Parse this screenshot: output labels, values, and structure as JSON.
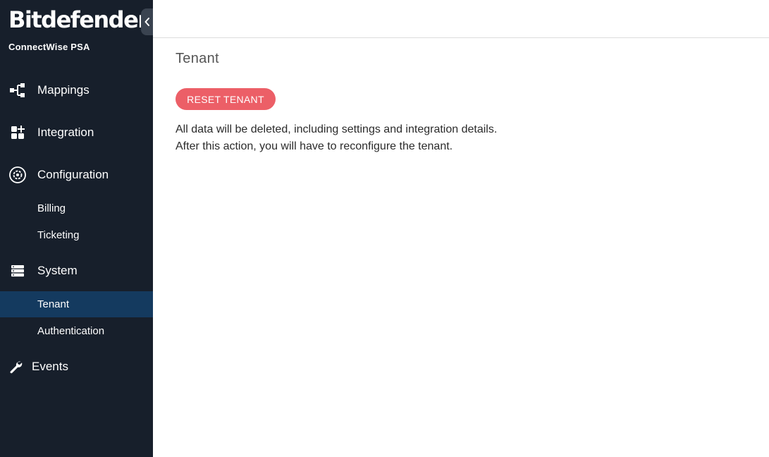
{
  "brand": {
    "name": "Bitdefender",
    "registered_mark": "®",
    "product": "ConnectWise PSA"
  },
  "sidebar": {
    "items": [
      {
        "label": "Mappings",
        "icon": "mappings-icon"
      },
      {
        "label": "Integration",
        "icon": "integration-icon"
      },
      {
        "label": "Configuration",
        "icon": "configuration-icon"
      },
      {
        "label": "Billing"
      },
      {
        "label": "Ticketing"
      },
      {
        "label": "System",
        "icon": "system-icon"
      },
      {
        "label": "Tenant",
        "active": true
      },
      {
        "label": "Authentication"
      },
      {
        "label": "Events",
        "icon": "wrench-icon"
      }
    ]
  },
  "main": {
    "title": "Tenant",
    "reset_button": "RESET TENANT",
    "description_line1": "All data will be deleted, including settings and integration details.",
    "description_line2": "After this action, you will have to reconfigure the tenant."
  },
  "colors": {
    "sidebar_bg": "#171f2b",
    "active_item_bg": "#143a5f",
    "reset_button_bg": "#ec5f67"
  }
}
